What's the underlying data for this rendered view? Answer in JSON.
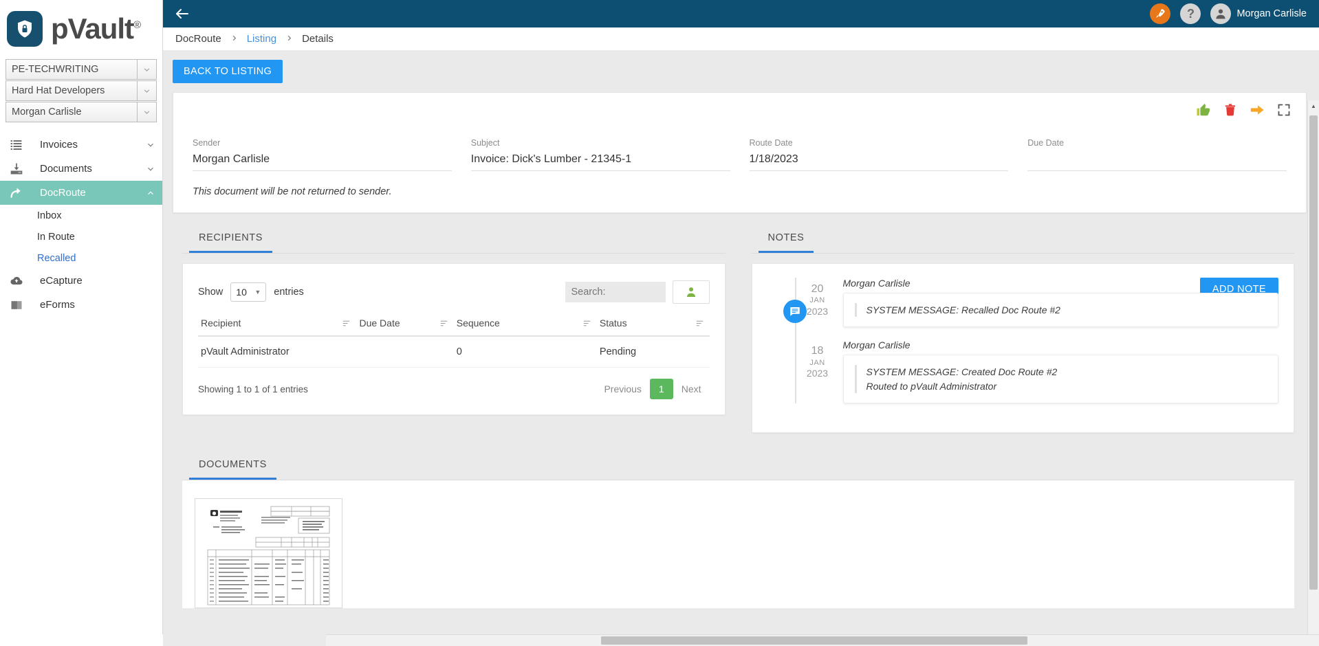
{
  "brand": {
    "name": "pVault",
    "trademark": "®",
    "logo_icon": "shield-lock-icon"
  },
  "sidebar": {
    "selectors": [
      {
        "label": "PE-TECHWRITING",
        "icon": "chevron-down-icon"
      },
      {
        "label": "Hard Hat Developers",
        "icon": "chevron-down-icon"
      },
      {
        "label": "Morgan Carlisle",
        "icon": "chevron-down-icon"
      }
    ],
    "nav": [
      {
        "label": "Invoices",
        "icon": "list-icon",
        "chevron": "chevron-down-icon",
        "active": false
      },
      {
        "label": "Documents",
        "icon": "inbox-download-icon",
        "chevron": "chevron-down-icon",
        "active": false
      },
      {
        "label": "DocRoute",
        "icon": "share-arrow-icon",
        "chevron": "chevron-up-icon",
        "active": true
      }
    ],
    "sub_items": [
      {
        "label": "Inbox",
        "selected": false
      },
      {
        "label": "In Route",
        "selected": false
      },
      {
        "label": "Recalled",
        "selected": true
      }
    ],
    "nav_bottom": [
      {
        "label": "eCapture",
        "icon": "cloud-upload-icon"
      },
      {
        "label": "eForms",
        "icon": "book-icon"
      }
    ]
  },
  "topbar": {
    "back_icon": "arrow-left-icon",
    "rocket_icon": "rocket-icon",
    "help_icon": "question-mark-icon",
    "avatar_icon": "user-avatar-icon",
    "user_name": "Morgan Carlisle",
    "bg_color": "#0d4f73",
    "rocket_color": "#e8771a"
  },
  "breadcrumb": {
    "root": "DocRoute",
    "middle": "Listing",
    "current": "Details",
    "separator": "›"
  },
  "toolbar": {
    "back_to_listing": "BACK TO LISTING"
  },
  "card_actions": [
    {
      "name": "approve-thumbs-up-icon",
      "color": "#7cb342"
    },
    {
      "name": "delete-trash-icon",
      "color": "#e53935"
    },
    {
      "name": "forward-arrow-icon",
      "color": "#f9a825"
    },
    {
      "name": "expand-fullscreen-icon",
      "color": "#555555"
    }
  ],
  "details": {
    "fields": [
      {
        "label": "Sender",
        "value": "Morgan Carlisle"
      },
      {
        "label": "Subject",
        "value": "Invoice: Dick's Lumber - 21345-1"
      },
      {
        "label": "Route Date",
        "value": "1/18/2023"
      },
      {
        "label": "Due Date",
        "value": ""
      }
    ],
    "return_note": "This document will be not returned to sender."
  },
  "recipients": {
    "tab_label": "RECIPIENTS",
    "show_label": "Show",
    "page_length": "10",
    "entries_label": "entries",
    "search_placeholder": "Search:",
    "search_value": "",
    "add_person_icon": "person-add-icon",
    "columns": [
      "Recipient",
      "Due Date",
      "Sequence",
      "Status"
    ],
    "rows": [
      {
        "recipient": "pVault Administrator",
        "due_date": "",
        "sequence": "0",
        "status": "Pending"
      }
    ],
    "info": "Showing 1 to 1 of 1 entries",
    "pagination": {
      "previous": "Previous",
      "current": "1",
      "next": "Next"
    }
  },
  "notes": {
    "tab_label": "NOTES",
    "add_note_label": "ADD NOTE",
    "bubble_icon": "comment-icon",
    "entries": [
      {
        "day": "20",
        "month": "JAN",
        "year": "2023",
        "author": "Morgan Carlisle",
        "lines": [
          "SYSTEM MESSAGE: Recalled Doc Route #2"
        ]
      },
      {
        "day": "18",
        "month": "JAN",
        "year": "2023",
        "author": "Morgan Carlisle",
        "lines": [
          "SYSTEM MESSAGE: Created Doc Route #2",
          "Routed to pVault Administrator"
        ]
      }
    ]
  },
  "documents": {
    "tab_label": "DOCUMENTS",
    "thumbnail_name": "invoice-document-thumbnail"
  }
}
